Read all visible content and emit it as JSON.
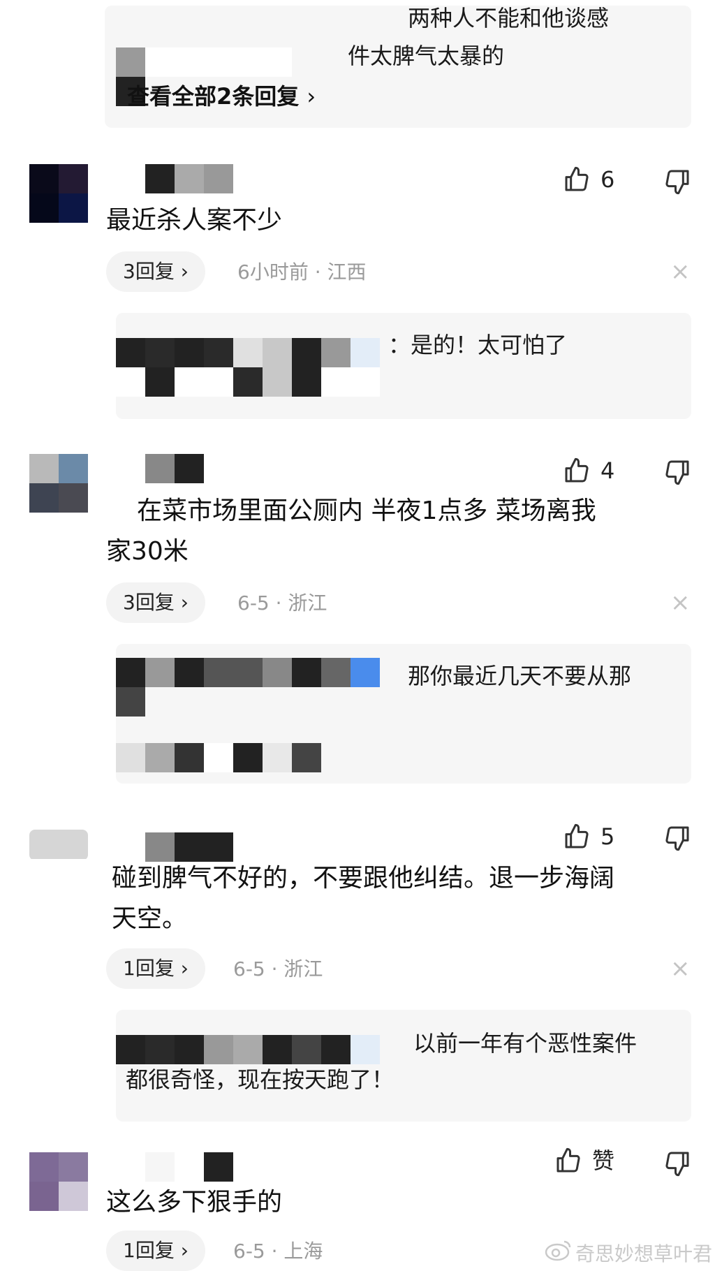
{
  "top_reply": {
    "line1": "两种人不能和他谈感",
    "line2": "件太脾气太暴的",
    "view_all": "查看全部2条回复",
    "chevron": "›"
  },
  "comments": [
    {
      "text": [
        "最近杀人案不少"
      ],
      "likes": "6",
      "reply_label": "3回复",
      "meta": "6小时前 · 江西",
      "sub_reply": [
        "：是的！太可怕了"
      ]
    },
    {
      "text": [
        "在菜市场里面公厕内 半夜1点多 菜场离我",
        "家30米"
      ],
      "likes": "4",
      "reply_label": "3回复",
      "meta": "6-5 · 浙江",
      "sub_reply": [
        "那你最近几天不要从那"
      ]
    },
    {
      "text": [
        "碰到脾气不好的，不要跟他纠结。退一步海阔",
        "天空。"
      ],
      "likes": "5",
      "reply_label": "1回复",
      "meta": "6-5 · 浙江",
      "sub_reply": [
        "以前一年有个恶性案件",
        "都很奇怪，现在按天跑了！"
      ]
    },
    {
      "text": [
        "这么多下狠手的"
      ],
      "likes": "赞",
      "reply_label": "1回复",
      "meta": "6-5 · 上海",
      "sub_reply": []
    }
  ],
  "icons": {
    "like": "thumbs-up-icon",
    "dislike": "thumbs-down-icon",
    "close": "close-icon",
    "close_glyph": "×",
    "reply_chevron": "›"
  },
  "watermark": "奇思妙想草叶君",
  "watermark_icon": "weibo-logo-icon"
}
